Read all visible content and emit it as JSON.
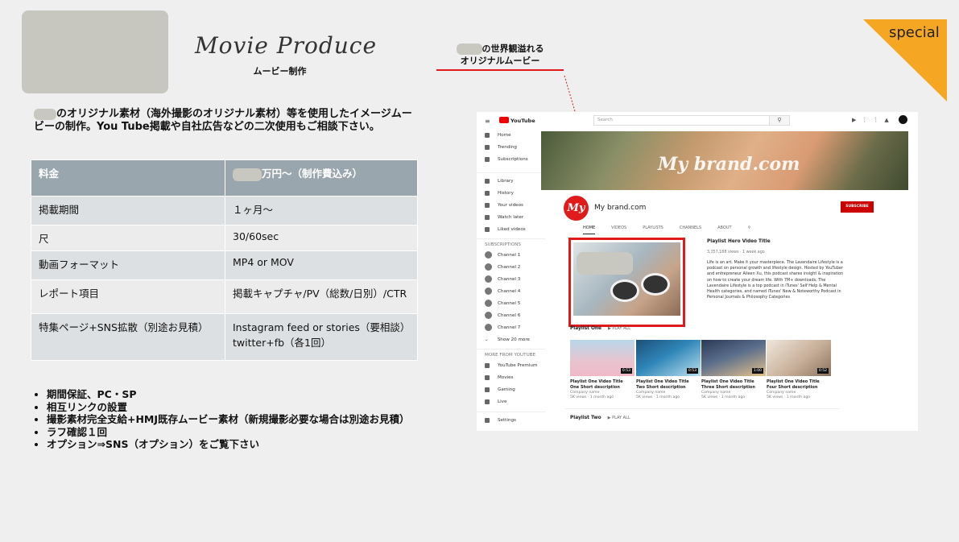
{
  "header": {
    "title_en": "Movie Produce",
    "title_ja": "ムービー制作",
    "badge": "special"
  },
  "colors": {
    "accent_orange": "#f5a623",
    "accent_red": "#e0191b",
    "table_header": "#9aa6ae"
  },
  "callout": {
    "line1_suffix": "の世界観溢れる",
    "line2": "オリジナルムービー"
  },
  "intro": {
    "text": "のオリジナル素材（海外撮影のオリジナル素材）等を使用したイメージムービーの制作。You Tube掲載や自社広告などの二次使用もご相談下さい。"
  },
  "table": {
    "header": {
      "label": "料金",
      "value_suffix": "万円〜（制作費込み）"
    },
    "rows": [
      {
        "label": "掲載期間",
        "value": "１ヶ月〜"
      },
      {
        "label": "尺",
        "value": "30/60sec"
      },
      {
        "label": "動画フォーマット",
        "value": "MP4 or MOV"
      },
      {
        "label": "レポート項目",
        "value": "掲載キャプチャ/PV（総数/日別）/CTR"
      },
      {
        "label": "特集ページ+SNS拡散（別途お見積）",
        "value": "Instagram feed or stories（要相談）twitter+fb（各1回）"
      }
    ]
  },
  "bullets": [
    "期間保証、PC・SP",
    "相互リンクの設置",
    "撮影素材完全支給+HMJ既存ムービー素材（新規撮影必要な場合は別途お見積）",
    "ラフ確認１回",
    "オプション⇒SNS（オプション）をご覧下さい"
  ],
  "youtube": {
    "logo_text": "YouTube",
    "search_placeholder": "Search",
    "sidebar": {
      "main": [
        "Home",
        "Trending",
        "Subscriptions"
      ],
      "library": [
        "Library",
        "History",
        "Your videos",
        "Watch later",
        "Liked videos"
      ],
      "subscriptions_heading": "SUBSCRIPTIONS",
      "channels": [
        "Channel 1",
        "Channel 2",
        "Channel 3",
        "Channel 4",
        "Channel 5",
        "Channel 6",
        "Channel 7"
      ],
      "show_more": "Show 20 more",
      "more_heading": "MORE FROM YOUTUBE",
      "more": [
        "YouTube Premium",
        "Movies",
        "Gaming",
        "Live"
      ],
      "settings": "Settings"
    },
    "banner_text": "My brand.com",
    "channel_logo": "My",
    "channel_name": "My brand.com",
    "subscribe": "SUBSCRIBE",
    "tabs": [
      "HOME",
      "VIDEOS",
      "PLAYLISTS",
      "CHANNELS",
      "ABOUT"
    ],
    "hero": {
      "title": "Playlist Hero Video Title",
      "meta": "3,357,188 views · 1 week ago",
      "desc": "Life is an art. Make it your masterpiece. The Lavendaire Lifestyle is a podcast on personal growth and lifestyle design. Hosted by YouTuber and entrepreneur Aileen Xu, this podcast shares insight & inspiration on how to create your dream life. With 7M+ downloads, The Lavendaire Lifestyle is a top podcast in iTunes' Self Help & Mental Health categories, and named iTunes' New & Noteworthy Podcast in Personal Journals & Philosophy Categories"
    },
    "playlist_one": "Playlist One",
    "playlist_two": "Playlist Two",
    "play_all": "PLAY ALL",
    "videos": [
      {
        "title": "Playlist One Video Title One Short description",
        "channel": "Company name",
        "meta": "5K views · 1 month ago",
        "duration": "0:53"
      },
      {
        "title": "Playlist One Video Title Two Short description",
        "channel": "Company name",
        "meta": "5K views · 1 month ago",
        "duration": "0:53"
      },
      {
        "title": "Playlist One Video Title Three Short description",
        "channel": "Company name",
        "meta": "5K views · 1 month ago",
        "duration": "1:00"
      },
      {
        "title": "Playlist One Video Title Four Short description",
        "channel": "Company name",
        "meta": "5K views · 1 month ago",
        "duration": "0:52"
      }
    ]
  }
}
